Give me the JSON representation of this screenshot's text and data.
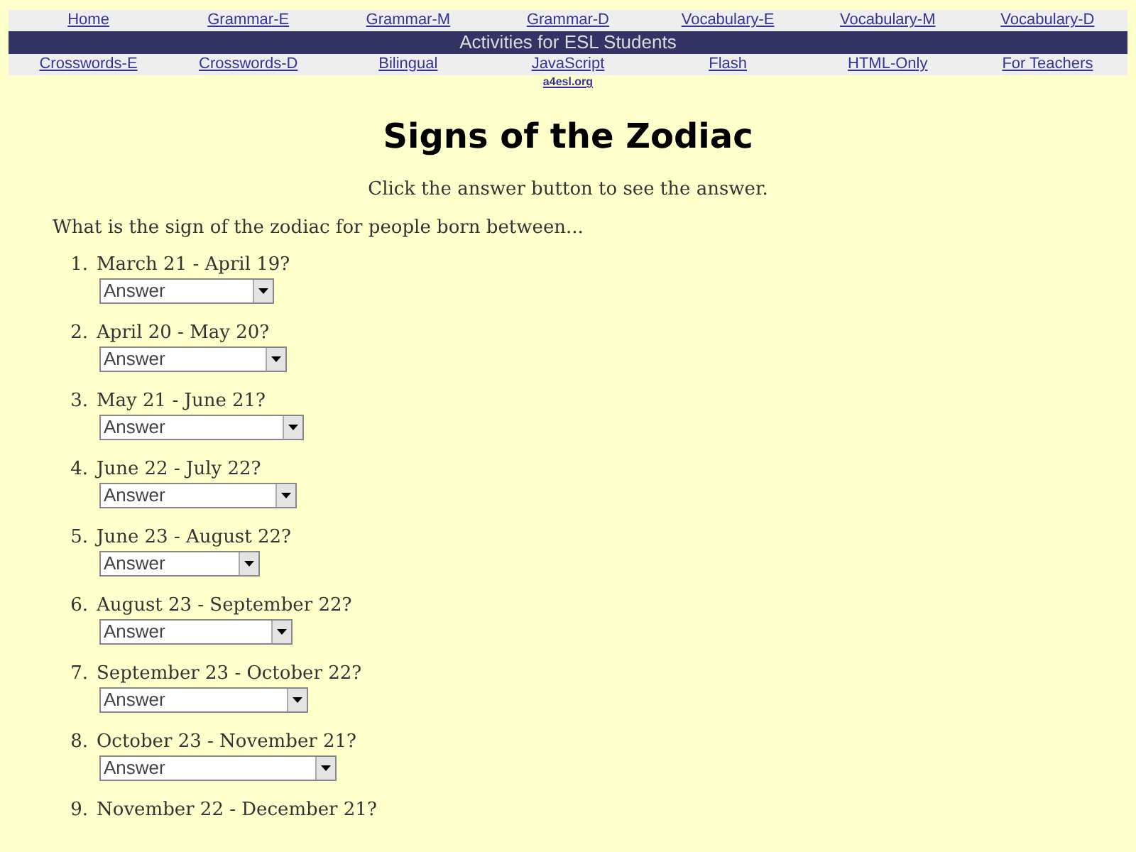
{
  "top_nav": [
    "Home",
    "Grammar-E",
    "Grammar-M",
    "Grammar-D",
    "Vocabulary-E",
    "Vocabulary-M",
    "Vocabulary-D"
  ],
  "banner": "Activities for ESL Students",
  "second_nav": [
    "Crosswords-E",
    "Crosswords-D",
    "Bilingual",
    "JavaScript",
    "Flash",
    "HTML-Only",
    "For Teachers"
  ],
  "site_link": "a4esl.org",
  "title": "Signs of the Zodiac",
  "instruction": "Click the answer button to see the answer.",
  "question": "What is the sign of the zodiac for people born between...",
  "items": [
    {
      "number": "1.",
      "text": "March 21 - April 19?",
      "answer": "Answer"
    },
    {
      "number": "2.",
      "text": "April 20 - May 20?",
      "answer": "Answer"
    },
    {
      "number": "3.",
      "text": "May 21 - June 21?",
      "answer": "Answer"
    },
    {
      "number": "4.",
      "text": "June 22 - July 22?",
      "answer": "Answer"
    },
    {
      "number": "5.",
      "text": "June 23 - August 22?",
      "answer": "Answer"
    },
    {
      "number": "6.",
      "text": "August 23 - September 22?",
      "answer": "Answer"
    },
    {
      "number": "7.",
      "text": "September 23 - October 22?",
      "answer": "Answer"
    },
    {
      "number": "8.",
      "text": "October 23 - November 21?",
      "answer": "Answer"
    },
    {
      "number": "9.",
      "text": "November 22 - December 21?"
    }
  ]
}
